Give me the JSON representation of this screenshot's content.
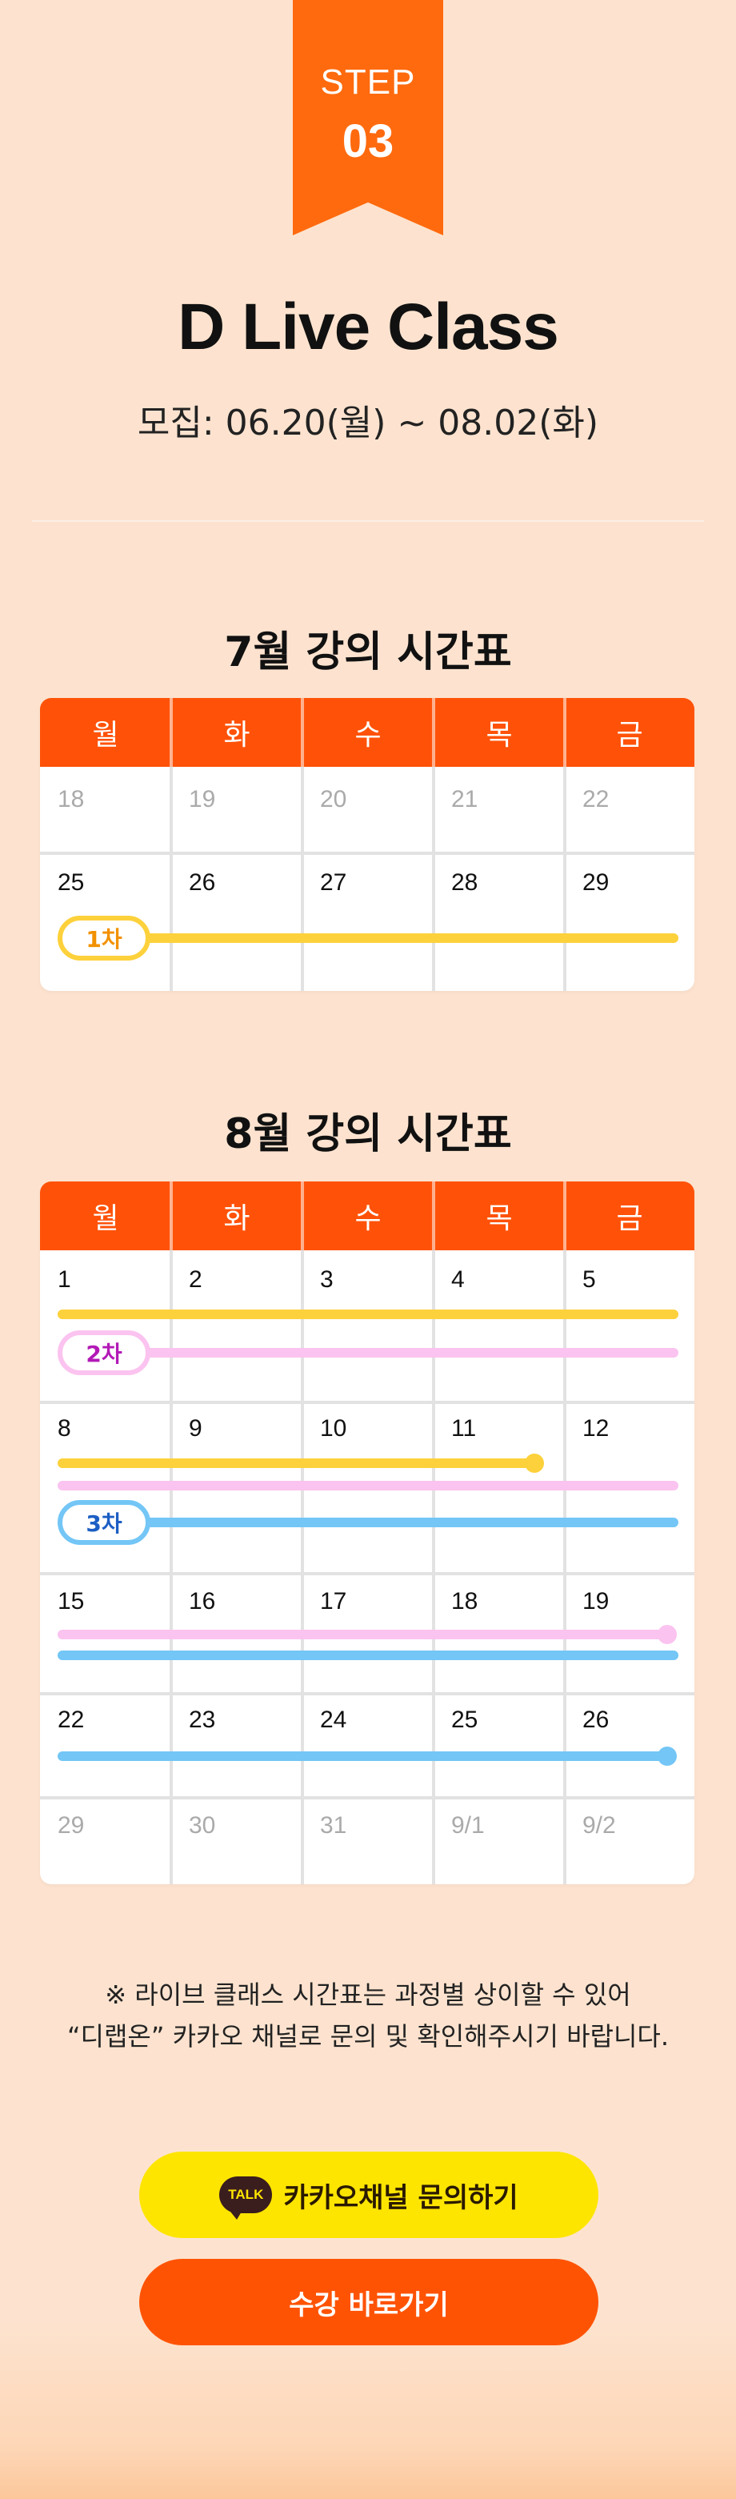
{
  "header": {
    "step_label": "STEP",
    "step_number": "03",
    "title": "D Live Class",
    "period": "모집: 06.20(월) ~ 08.02(화)"
  },
  "weekdays": [
    "월",
    "화",
    "수",
    "목",
    "금"
  ],
  "july": {
    "title": "7월 강의 시간표",
    "weeks": [
      [
        "18",
        "19",
        "20",
        "21",
        "22"
      ],
      [
        "25",
        "26",
        "27",
        "28",
        "29"
      ]
    ],
    "round_label": "1차"
  },
  "august": {
    "title": "8월 강의 시간표",
    "weeks": [
      [
        "1",
        "2",
        "3",
        "4",
        "5"
      ],
      [
        "8",
        "9",
        "10",
        "11",
        "12"
      ],
      [
        "15",
        "16",
        "17",
        "18",
        "19"
      ],
      [
        "22",
        "23",
        "24",
        "25",
        "26"
      ],
      [
        "29",
        "30",
        "31",
        "9/1",
        "9/2"
      ]
    ],
    "round2_label": "2차",
    "round3_label": "3차"
  },
  "notice": {
    "line1": "※ 라이브 클래스 시간표는 과정별 상이할 수 있어",
    "line2": "“디랩온” 카카오 채널로 문의 및 확인해주시기 바랍니다."
  },
  "buttons": {
    "kakao_badge": "TALK",
    "kakao_label": "카카오채널 문의하기",
    "enroll_label": "수강 바로가기"
  },
  "colors": {
    "accent": "#ff5208",
    "round1": "#fdd13b",
    "round2": "#fbc3ef",
    "round3": "#73c6f6",
    "kakao": "#fee500"
  }
}
